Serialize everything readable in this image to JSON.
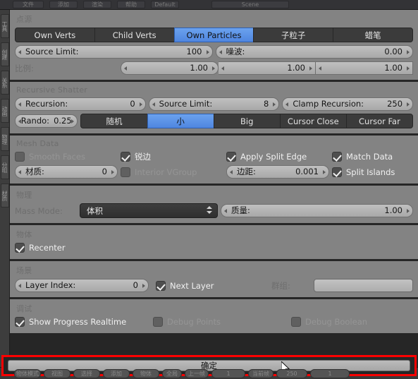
{
  "window": {
    "title_bg_chips": [
      "文件",
      "添加",
      "渲染",
      "帮助",
      "Default",
      "Scene"
    ],
    "bottom_chips": [
      "物体模式",
      "视图",
      "选择",
      "添加",
      "物体",
      "全局",
      "上一帧",
      "1",
      "当前帧",
      "250",
      "1"
    ]
  },
  "sidebar_tabs": [
    "工具",
    "创建",
    "关系",
    "动画",
    "物理",
    "分组",
    "材质"
  ],
  "panels": [
    {
      "title": "点源",
      "toggle_buttons": [
        {
          "label": "Own Verts",
          "active": false
        },
        {
          "label": "Child Verts",
          "active": false
        },
        {
          "label": "Own Particles",
          "active": true
        },
        {
          "label": "子粒子",
          "active": false
        },
        {
          "label": "蜡笔",
          "active": false
        }
      ],
      "fields": [
        {
          "label": "Source Limit:",
          "value": "100"
        },
        {
          "label": "噪波:",
          "value": "0.00"
        }
      ],
      "scale_label": "比例:",
      "scale_values": [
        "1.00",
        "1.00",
        "1.00"
      ]
    },
    {
      "title": "Recursive Shatter",
      "fields": [
        {
          "label": "Recursion:",
          "value": "0"
        },
        {
          "label": "Source Limit:",
          "value": "8"
        },
        {
          "label": "Clamp Recursion:",
          "value": "250"
        }
      ],
      "rando": {
        "label": "Rando:",
        "value": "0.25"
      },
      "toggle_buttons": [
        {
          "label": "随机",
          "active": false
        },
        {
          "label": "小",
          "active": true
        },
        {
          "label": "Big",
          "active": false
        },
        {
          "label": "Cursor Close",
          "active": false
        },
        {
          "label": "Cursor Far",
          "active": false
        }
      ]
    },
    {
      "title": "Mesh Data",
      "checks": [
        {
          "label": "Smooth Faces",
          "checked": false,
          "dim": true
        },
        {
          "label": "锐边",
          "checked": true,
          "dim": false
        },
        {
          "label": "Apply Split Edge",
          "checked": true,
          "dim": false
        },
        {
          "label": "Match Data",
          "checked": true,
          "dim": false
        },
        {
          "label": "Interior VGroup",
          "checked": false,
          "dim": true
        },
        {
          "label": "Split Islands",
          "checked": true,
          "dim": false
        }
      ],
      "material": {
        "label": "材质:",
        "value": "0"
      },
      "margin": {
        "label": "边距:",
        "value": "0.001"
      }
    },
    {
      "title": "物理",
      "mass_mode_label": "Mass Mode:",
      "mass_mode_value": "体积",
      "mass": {
        "label": "质量:",
        "value": "1.00"
      }
    },
    {
      "title": "物体",
      "recenter": {
        "label": "Recenter",
        "checked": true
      }
    },
    {
      "title": "场景",
      "layer_index": {
        "label": "Layer Index:",
        "value": "0"
      },
      "next_layer": {
        "label": "Next Layer",
        "checked": true
      },
      "group_label": "群组:",
      "group_value": ""
    },
    {
      "title": "调试",
      "checks": [
        {
          "label": "Show Progress Realtime",
          "checked": true,
          "dim": false
        },
        {
          "label": "Debug Points",
          "checked": false,
          "dim": true
        },
        {
          "label": "Debug Boolean",
          "checked": false,
          "dim": true
        }
      ]
    }
  ],
  "confirm_button": "确定",
  "colors": {
    "panel_bg": "#838383",
    "accent_blue": "#5f93e6",
    "highlight_red": "#ff0000",
    "dialog_bg": "#262626"
  }
}
